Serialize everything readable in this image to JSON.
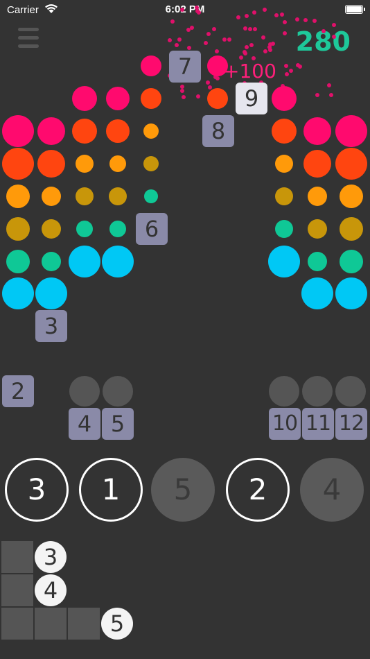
{
  "status_bar": {
    "carrier": "Carrier",
    "time": "6:02 PM"
  },
  "score": "280",
  "bonus": "+100",
  "colors": {
    "pink": "#ff0a6e",
    "red": "#ff4510",
    "orange": "#ff9a0a",
    "mustard": "#c8960a",
    "green": "#0fc896",
    "cyan": "#00c8f5",
    "tile": "#8a8aa8",
    "tile_highlight": "#e6e6ee",
    "score_green": "#1ec89a",
    "background": "#333333"
  },
  "tiles": {
    "t7": "7",
    "t9": "9",
    "t8": "8",
    "t6": "6",
    "t3": "3",
    "t2": "2",
    "t4": "4",
    "t5": "5",
    "t10": "10",
    "t11": "11",
    "t12": "12"
  },
  "choices": [
    "3",
    "1",
    "5",
    "2",
    "4"
  ],
  "preview_numbers": [
    "3",
    "4",
    "5"
  ]
}
